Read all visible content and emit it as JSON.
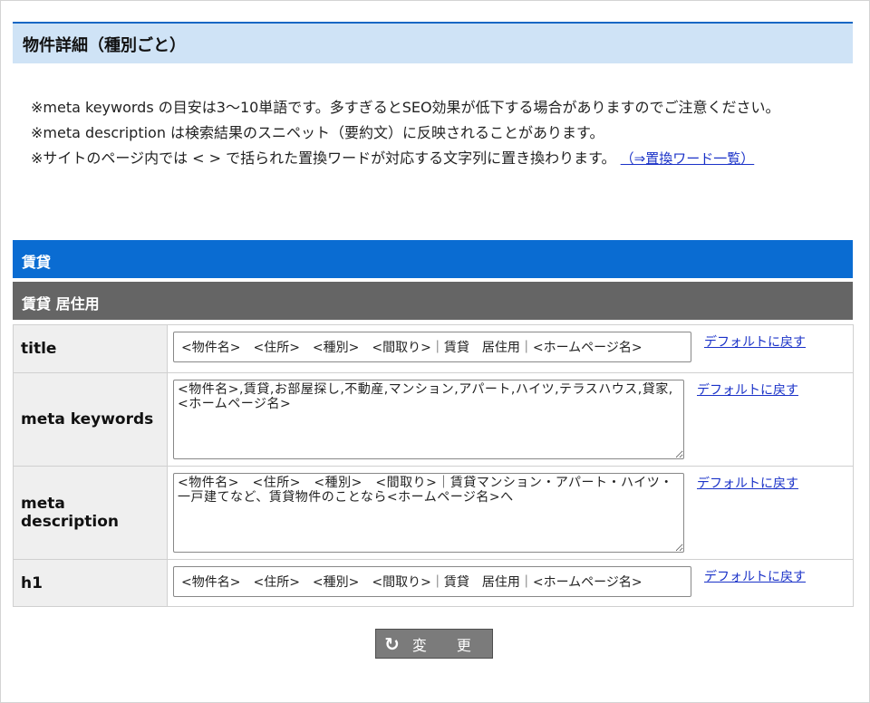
{
  "section_title": "物件詳細（種別ごと）",
  "notes": {
    "line1": "※meta keywords の目安は3～10単語です。多すぎるとSEO効果が低下する場合がありますのでご注意ください。",
    "line2": "※meta description は検索結果のスニペット（要約文）に反映されることがあります。",
    "line3": "※サイトのページ内では < > で括られた置換ワードが対応する文字列に置き換わります。",
    "line3_link": "（⇒置換ワード一覧）"
  },
  "category": "賃貸",
  "subcategory": "賃貸 居住用",
  "rows": [
    {
      "label": "title",
      "value": "<物件名>　<住所>　<種別>　<間取り>｜賃貸　居住用｜<ホームページ名>",
      "reset": "デフォルトに戻す"
    },
    {
      "label": "meta keywords",
      "value": "<物件名>,賃貸,お部屋探し,不動産,マンション,アパート,ハイツ,テラスハウス,貸家,<ホームページ名>",
      "reset": "デフォルトに戻す"
    },
    {
      "label": "meta description",
      "value": "<物件名>　<住所>　<種別>　<間取り>｜賃貸マンション・アパート・ハイツ・一戸建てなど、賃貸物件のことなら<ホームページ名>へ",
      "reset": "デフォルトに戻す"
    },
    {
      "label": "h1",
      "value": "<物件名>　<住所>　<種別>　<間取り>｜賃貸　居住用｜<ホームページ名>",
      "reset": "デフォルトに戻す"
    }
  ],
  "submit_label": "変 更",
  "submit_icon": "refresh-icon"
}
